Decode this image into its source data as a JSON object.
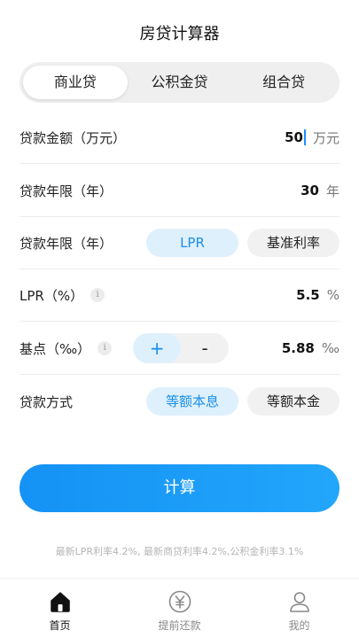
{
  "header": {
    "title": "房贷计算器"
  },
  "loan_types": [
    {
      "label": "商业贷",
      "active": true
    },
    {
      "label": "公积金贷",
      "active": false
    },
    {
      "label": "组合贷",
      "active": false
    }
  ],
  "form": {
    "amount": {
      "label": "贷款金额（万元）",
      "value": "50",
      "unit": "万元"
    },
    "term": {
      "label": "贷款年限（年）",
      "value": "30",
      "unit": "年"
    },
    "rate_type": {
      "label": "贷款年限（年）",
      "options": [
        "LPR",
        "基准利率"
      ],
      "selected": "LPR"
    },
    "lpr": {
      "label": "LPR（%）",
      "value": "5.5",
      "unit": "%"
    },
    "basis": {
      "label": "基点（‰）",
      "plus": "+",
      "minus": "-",
      "value": "5.88",
      "unit": "‰"
    },
    "method": {
      "label": "贷款方式",
      "options": [
        "等额本息",
        "等额本金"
      ],
      "selected": "等额本息"
    }
  },
  "calculate_label": "计算",
  "footnote": "最新LPR利率4.2%, 最新商贷利率4.2%,公积金利率3.1%",
  "tabbar": [
    {
      "label": "首页",
      "icon": "home-icon",
      "active": true
    },
    {
      "label": "提前还款",
      "icon": "yuan-icon",
      "active": false
    },
    {
      "label": "我的",
      "icon": "user-icon",
      "active": false
    }
  ],
  "colors": {
    "accent": "#1a8fe6",
    "button": "#1592f5",
    "pill_active_bg": "#dff0fd"
  }
}
